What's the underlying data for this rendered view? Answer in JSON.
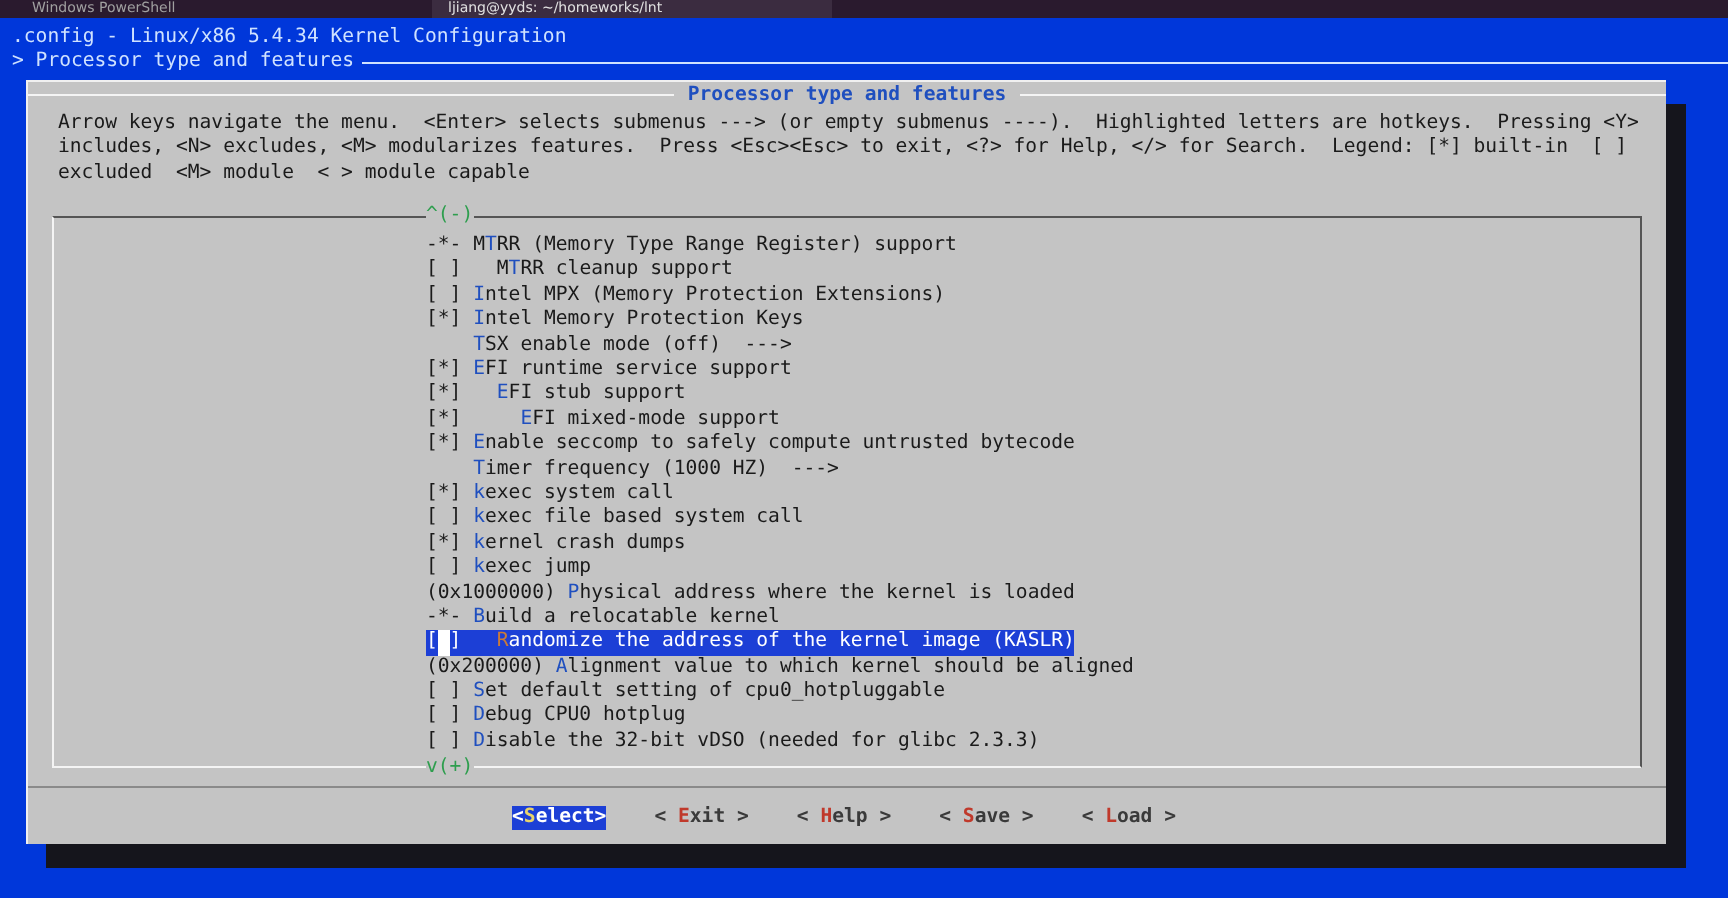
{
  "terminal_tabs": [
    {
      "title": "Windows PowerShell",
      "selected": false
    },
    {
      "title": "ljiang@yyds: ~/homeworks/lnt",
      "selected": true
    }
  ],
  "header": {
    "title": ".config - Linux/x86 5.4.34 Kernel Configuration",
    "breadcrumb": "> Processor type and features"
  },
  "dialog": {
    "title": "Processor type and features",
    "help_lines": [
      "Arrow keys navigate the menu.  <Enter> selects submenus ---> (or empty submenus ----).  Highlighted letters are hotkeys.  Pressing <Y>",
      "includes, <N> excludes, <M> modularizes features.  Press <Esc><Esc> to exit, <?> for Help, </> for Search.  Legend: [*] built-in  [ ]",
      "excluded  <M> module  < > module capable"
    ],
    "scroll_up": "^(-)",
    "scroll_down": "v(+)",
    "items": [
      {
        "prefix": "-*-",
        "before": "M",
        "hotkey": "T",
        "after": "RR (Memory Type Range Register) support",
        "selected": false,
        "children": [
          {
            "prefix": "[ ]",
            "before": "M",
            "hotkey": "T",
            "after": "RR cleanup support",
            "selected": false
          }
        ]
      },
      {
        "prefix": "[ ]",
        "hotkey": "I",
        "after": "ntel MPX (Memory Protection Extensions)",
        "selected": false
      },
      {
        "prefix": "[*]",
        "hotkey": "I",
        "after": "ntel Memory Protection Keys",
        "selected": false
      },
      {
        "hotkey": "T",
        "after": "SX enable mode (off)  --->",
        "selected": false
      },
      {
        "prefix": "[*]",
        "hotkey": "E",
        "after": "FI runtime service support",
        "selected": false,
        "children": [
          {
            "prefix": "[*]",
            "hotkey": "E",
            "after": "FI stub support",
            "selected": false,
            "children": [
              {
                "prefix": "[*]",
                "hotkey": "E",
                "after": "FI mixed-mode support",
                "selected": false
              }
            ]
          }
        ]
      },
      {
        "prefix": "[*]",
        "hotkey": "E",
        "after": "nable seccomp to safely compute untrusted bytecode",
        "selected": false
      },
      {
        "hotkey": "T",
        "after": "imer frequency (1000 HZ)  --->",
        "selected": false
      },
      {
        "prefix": "[*]",
        "hotkey": "k",
        "after": "exec system call",
        "selected": false
      },
      {
        "prefix": "[ ]",
        "hotkey": "k",
        "after": "exec file based system call",
        "selected": false
      },
      {
        "prefix": "[*]",
        "hotkey": "k",
        "after": "ernel crash dumps",
        "selected": false
      },
      {
        "prefix": "[ ]",
        "hotkey": "k",
        "after": "exec jump",
        "selected": false
      },
      {
        "prefix": "(0x1000000)",
        "hotkey": "P",
        "after": "hysical address where the kernel is loaded",
        "selected": false
      },
      {
        "prefix": "-*-",
        "hotkey": "B",
        "after": "uild a relocatable kernel",
        "selected": false,
        "children": [
          {
            "prefix": "[ ]",
            "hotkey": "R",
            "after": "andomize the address of the kernel image (KASLR)",
            "selected": true
          }
        ]
      },
      {
        "prefix": "(0x200000)",
        "hotkey": "A",
        "after": "lignment value to which kernel should be aligned",
        "selected": false
      },
      {
        "prefix": "[ ]",
        "hotkey": "S",
        "after": "et default setting of cpu0_hotpluggable",
        "selected": false
      },
      {
        "prefix": "[ ]",
        "hotkey": "D",
        "after": "ebug CPU0 hotplug",
        "selected": false
      },
      {
        "prefix": "[ ]",
        "hotkey": "D",
        "after": "isable the 32-bit vDSO (needed for glibc 2.3.3)",
        "selected": false
      }
    ],
    "buttons": [
      {
        "before": "<",
        "hotkey": "S",
        "after": "elect>",
        "selected": true
      },
      {
        "before": "< ",
        "hotkey": "E",
        "after": "xit >",
        "selected": false
      },
      {
        "before": "< ",
        "hotkey": "H",
        "after": "elp >",
        "selected": false
      },
      {
        "before": "< ",
        "hotkey": "S",
        "after": "ave >",
        "selected": false
      },
      {
        "before": "< ",
        "hotkey": "L",
        "after": "oad >",
        "selected": false
      }
    ]
  }
}
